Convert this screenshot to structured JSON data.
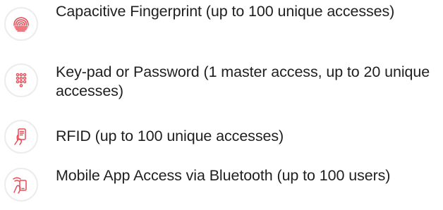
{
  "colors": {
    "accent": "#e84b55",
    "icon_ring": "#ececec",
    "text": "#1f1f1f"
  },
  "features": [
    {
      "icon": "fingerprint-icon",
      "label": "Capacitive Fingerprint (up to 100 unique accesses)"
    },
    {
      "icon": "keypad-icon",
      "label": "Key-pad or Password (1 master access, up to 20 unique accesses)"
    },
    {
      "icon": "rfid-card-icon",
      "label": "RFID (up to 100 unique accesses)"
    },
    {
      "icon": "mobile-bluetooth-icon",
      "label": "Mobile App Access via Bluetooth (up to 100 users)"
    }
  ]
}
